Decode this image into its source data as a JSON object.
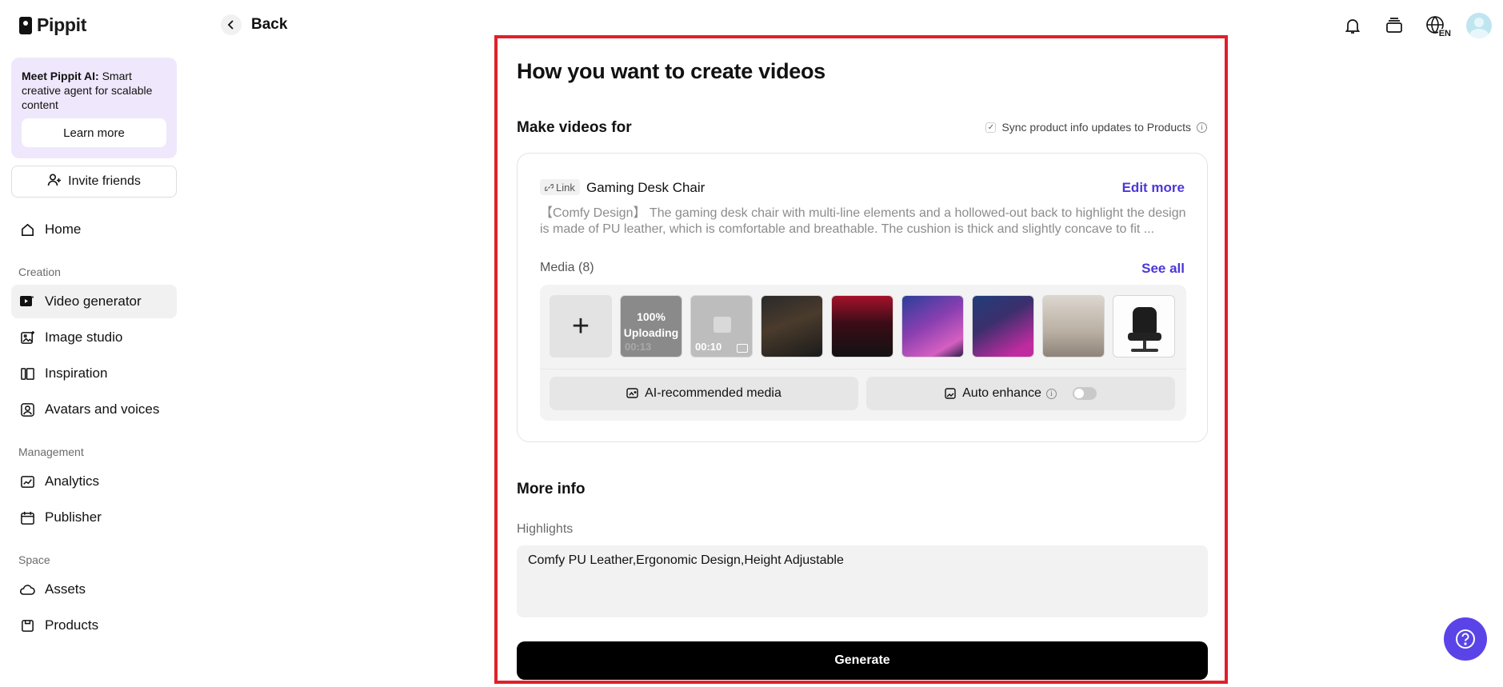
{
  "brand": {
    "name": "Pippit"
  },
  "sidebar": {
    "promo": {
      "title": "Meet Pippit AI:",
      "text": " Smart creative agent for scalable content",
      "button": "Learn more"
    },
    "invite_label": "Invite friends",
    "home": "Home",
    "sections": {
      "creation": "Creation",
      "management": "Management",
      "space": "Space"
    },
    "items": {
      "video_generator": "Video generator",
      "image_studio": "Image studio",
      "inspiration": "Inspiration",
      "avatars_voices": "Avatars and voices",
      "analytics": "Analytics",
      "publisher": "Publisher",
      "assets": "Assets",
      "products": "Products"
    }
  },
  "topbar": {
    "back_label": "Back",
    "language": "EN",
    "icons": [
      "bell-icon",
      "layers-icon",
      "globe-icon",
      "avatar"
    ]
  },
  "main": {
    "title": "How you want to create videos",
    "make_videos_for": "Make videos for",
    "sync_label": "Sync product info updates to Products",
    "product": {
      "link_chip": "Link",
      "name": "Gaming Desk Chair",
      "edit_more": "Edit more",
      "description": "【Comfy Design】 The gaming desk chair with multi-line elements and a hollowed-out back to highlight the design is made of PU leather, which is comfortable and breathable. The cushion is thick and slightly concave to fit ..."
    },
    "media": {
      "label": "Media (8)",
      "see_all": "See all",
      "uploading": {
        "percent": "100%",
        "label": "Uploading",
        "duration": "00:13"
      },
      "video_duration": "00:10",
      "ai_recommended": "AI-recommended media",
      "auto_enhance": "Auto enhance",
      "auto_enhance_on": false
    },
    "more_info": "More info",
    "highlights_label": "Highlights",
    "highlights_value": "Comfy PU Leather,Ergonomic Design,Height Adjustable",
    "generate": "Generate"
  },
  "colors": {
    "accent": "#4a38d8",
    "highlight_border": "#e0202a",
    "help_button": "#5a44e8"
  }
}
